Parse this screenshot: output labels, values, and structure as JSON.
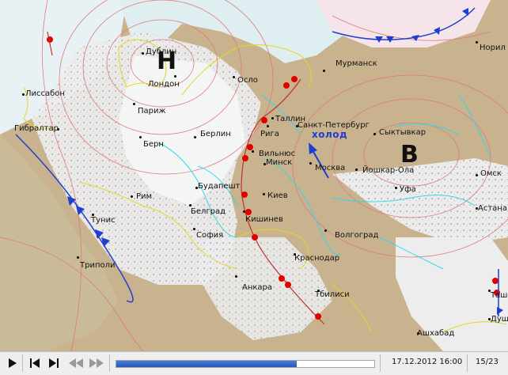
{
  "map": {
    "pressure_low": "Н",
    "pressure_high": "В",
    "cold_label": "холод",
    "cities": [
      {
        "name": "Дублин"
      },
      {
        "name": "Лондон"
      },
      {
        "name": "Лиссабон"
      },
      {
        "name": "Париж"
      },
      {
        "name": "Гибралтар"
      },
      {
        "name": "Берн"
      },
      {
        "name": "Осло"
      },
      {
        "name": "Берлин"
      },
      {
        "name": "Рига"
      },
      {
        "name": "Таллин"
      },
      {
        "name": "Вильнюс"
      },
      {
        "name": "Минск"
      },
      {
        "name": "Санкт-Петербург"
      },
      {
        "name": "Мурманск"
      },
      {
        "name": "Сыктывкар"
      },
      {
        "name": "Москва"
      },
      {
        "name": "Йошкар-Ола"
      },
      {
        "name": "Уфа"
      },
      {
        "name": "Омск"
      },
      {
        "name": "Норил"
      },
      {
        "name": "Астана"
      },
      {
        "name": "Рим"
      },
      {
        "name": "Будапешт"
      },
      {
        "name": "Киев"
      },
      {
        "name": "Белград"
      },
      {
        "name": "Кишинев"
      },
      {
        "name": "Тунис"
      },
      {
        "name": "София"
      },
      {
        "name": "Волгоград"
      },
      {
        "name": "Триполи"
      },
      {
        "name": "Краснодар"
      },
      {
        "name": "Анкара"
      },
      {
        "name": "Тбилиси"
      },
      {
        "name": "Ашхабад"
      },
      {
        "name": "Таш"
      },
      {
        "name": "Душ"
      }
    ]
  },
  "toolbar": {
    "datetime": "17.12.2012 16:00",
    "frame": "15/23",
    "progress": 0.7
  },
  "colors": {
    "cold_front": "#1f3ed0",
    "warm_front": "#e00000",
    "isobar": "#e07a7a",
    "coastline": "#e8e038",
    "rivers": "#2fd8e8",
    "land": "#c8b38e"
  },
  "icons": [
    "play-icon",
    "step-back-icon",
    "step-forward-icon",
    "rewind-icon",
    "fast-forward-icon"
  ]
}
